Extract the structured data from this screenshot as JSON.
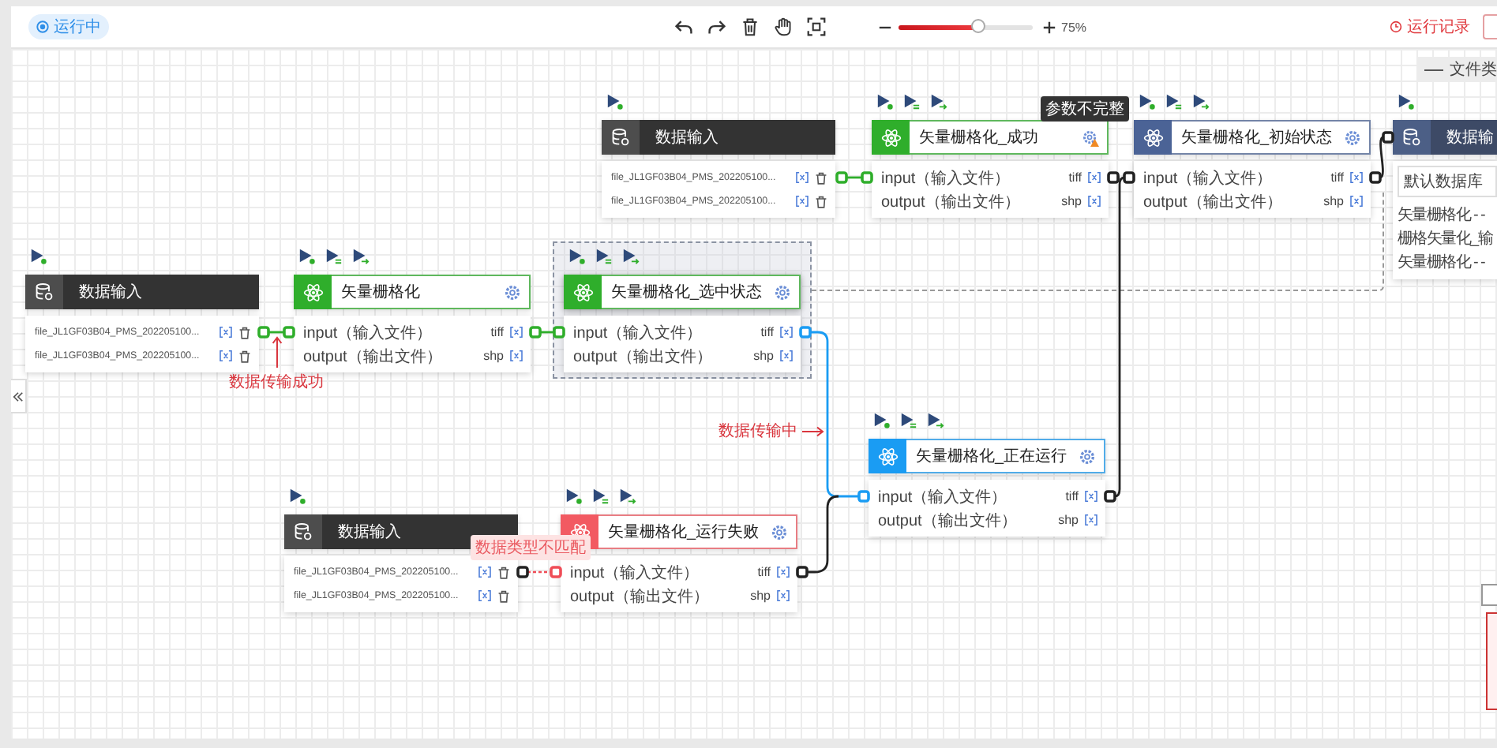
{
  "toolbar": {
    "status": "运行中",
    "zoom": {
      "level": 0.6,
      "reading": "75%"
    },
    "history": "运行记录"
  },
  "legend": {
    "label": "文件类"
  },
  "nodes": [
    {
      "kind": "data",
      "title": "数据输入",
      "selected": false,
      "files": [
        "file_JL1GF03B04_PMS_202205100...",
        "file_JL1GF03B04_PMS_202205100..."
      ]
    },
    {
      "kind": "process",
      "title": "矢量栅格化_成功",
      "color": "#2fae2b",
      "selected": false,
      "warning": "参数不完整",
      "ports": [
        {
          "name": "input（输入文件）",
          "format": "tiff"
        },
        {
          "name": "output（输出文件）",
          "format": "shp"
        }
      ]
    },
    {
      "kind": "process",
      "title": "矢量栅格化_初始状态",
      "color": "#4b6396",
      "selected": false,
      "ports": [
        {
          "name": "input（输入文件）",
          "format": "tiff"
        },
        {
          "name": "output（输出文件）",
          "format": "shp"
        }
      ]
    },
    {
      "kind": "output",
      "title": "数据输",
      "selected": false,
      "database": "默认数据库",
      "items": [
        "矢量栅格化 - -",
        "栅格矢量化_输",
        "矢量栅格化 - -"
      ]
    },
    {
      "kind": "data",
      "title": "数据输入",
      "selected": false,
      "files": [
        "file_JL1GF03B04_PMS_202205100...",
        "file_JL1GF03B04_PMS_202205100..."
      ]
    },
    {
      "kind": "process",
      "title": "矢量栅格化",
      "color": "#2fae2b",
      "selected": false,
      "ports": [
        {
          "name": "input（输入文件）",
          "format": "tiff"
        },
        {
          "name": "output（输出文件）",
          "format": "shp"
        }
      ]
    },
    {
      "kind": "process",
      "title": "矢量栅格化_选中状态",
      "color": "#2fae2b",
      "selected": true,
      "ports": [
        {
          "name": "input（输入文件）",
          "format": "tiff"
        },
        {
          "name": "output（输出文件）",
          "format": "shp"
        }
      ]
    },
    {
      "kind": "process",
      "title": "矢量栅格化_正在运行",
      "color": "#1a9cf3",
      "selected": false,
      "ports": [
        {
          "name": "input（输入文件）",
          "format": "tiff"
        },
        {
          "name": "output（输出文件）",
          "format": "shp"
        }
      ]
    },
    {
      "kind": "data",
      "title": "数据输入",
      "selected": false,
      "files": [
        "file_JL1GF03B04_PMS_202205100...",
        "file_JL1GF03B04_PMS_202205100..."
      ]
    },
    {
      "kind": "process",
      "title": "矢量栅格化_运行失败",
      "color": "#f25a62",
      "selected": false,
      "ports": [
        {
          "name": "input（输入文件）",
          "format": "tiff"
        },
        {
          "name": "output（输出文件）",
          "format": "shp"
        }
      ]
    }
  ],
  "annotations": [
    {
      "kind": "success",
      "text": "数据传输成功"
    },
    {
      "kind": "progress",
      "text": "数据传输中"
    },
    {
      "kind": "error",
      "text": "数据类型不匹配"
    }
  ]
}
